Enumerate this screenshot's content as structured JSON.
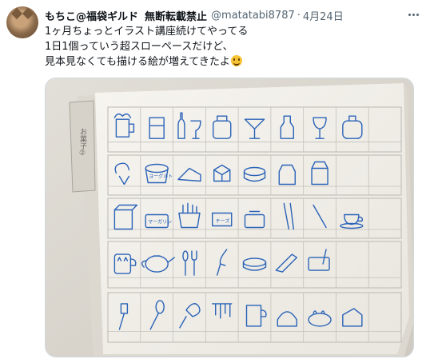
{
  "tweet": {
    "display_name": "もちこ@福袋ギルド",
    "badge_text": "無断転載禁止",
    "handle": "@matatabi8787",
    "separator": "·",
    "time": "4月24日",
    "lines": [
      "1ヶ月ちょっとイラスト講座続けてやってる",
      "1日1個っていう超スローペースだけど、",
      "見本見なくても描ける絵が増えてきたよ"
    ],
    "emoji": "grinning-face",
    "media": {
      "folder_tab_text": "お菓子②",
      "drawn_labels": [
        "ヨーグルト",
        "マーガリン",
        "チーズ"
      ],
      "ink_color": "#2b63b8",
      "grid_color": "#c4c1bb",
      "paper_color": "#f4f2ed"
    }
  }
}
